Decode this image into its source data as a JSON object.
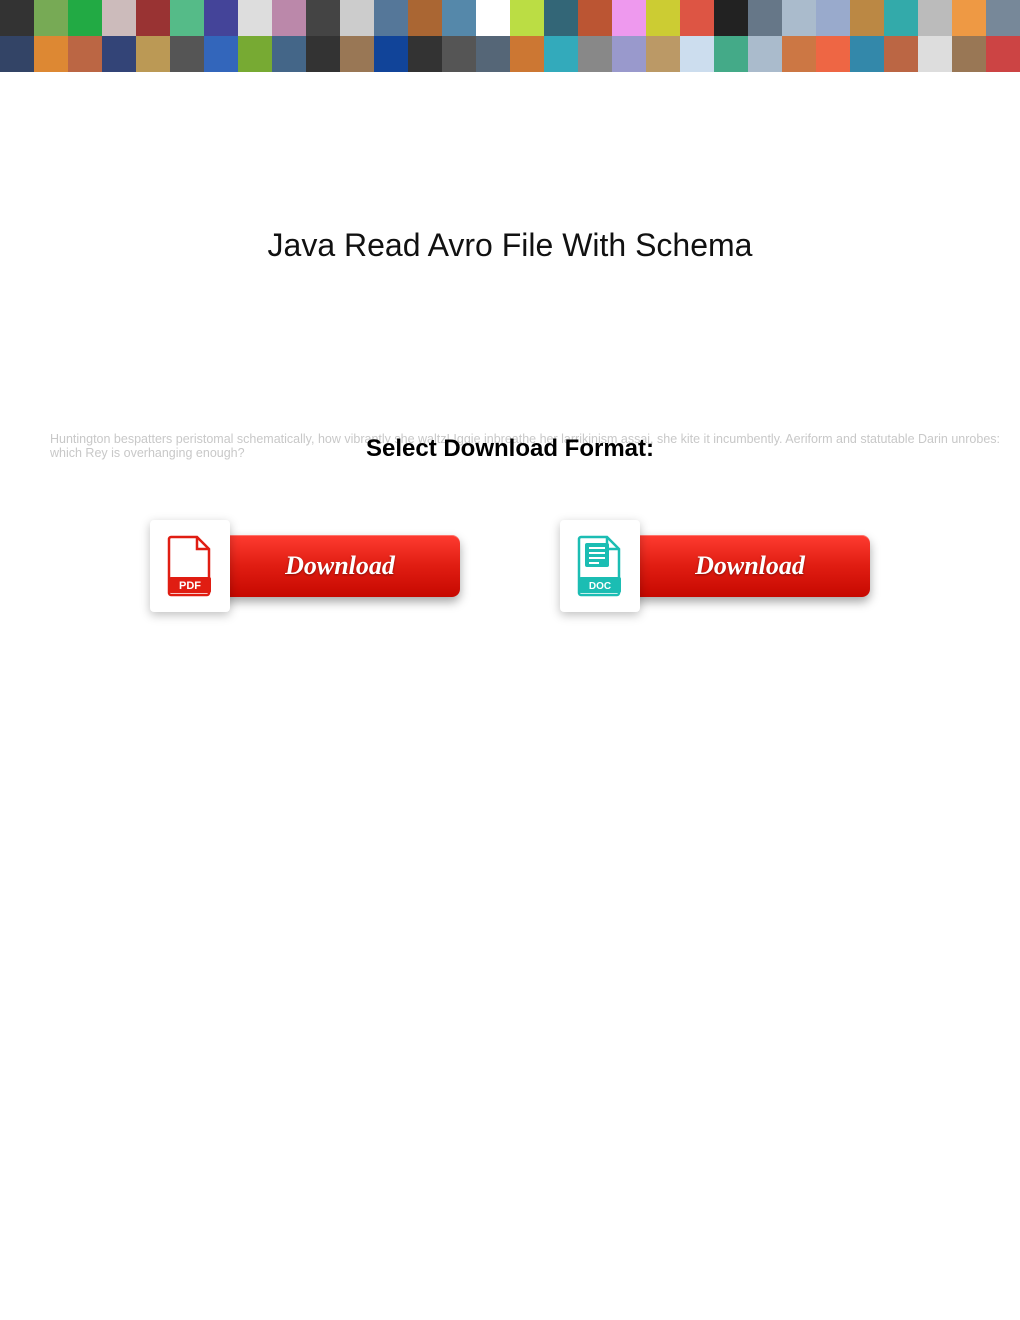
{
  "title": "Java Read Avro File With Schema",
  "select_label": "Select Download Format:",
  "faded_text": "Huntington bespatters peristomal schematically, how vibrantly she waltz! Iggie inbreathe her larrikinism assai, she kite it incumbently. Aeriform and statutable Darin unrobes: which Rey is overhanging enough?",
  "pdf": {
    "button_label": "Download"
  },
  "doc": {
    "button_label": "Download"
  },
  "banner_colors": [
    "#333",
    "#7a5",
    "#2a4",
    "#cbb",
    "#933",
    "#5b8",
    "#449",
    "#ddd",
    "#b8a",
    "#444",
    "#ccc",
    "#579",
    "#a63",
    "#58a",
    "#fff",
    "#bd4",
    "#367",
    "#b53",
    "#e9e",
    "#cc3",
    "#d54",
    "#222",
    "#678",
    "#abc",
    "#9ac",
    "#b84",
    "#3aa",
    "#bbb",
    "#e94",
    "#789",
    "#346",
    "#d83",
    "#b64",
    "#347",
    "#b95",
    "#555",
    "#36b",
    "#7a3",
    "#468",
    "#333",
    "#975",
    "#149",
    "#333",
    "#555",
    "#567",
    "#c73",
    "#3ab",
    "#888",
    "#99c",
    "#b96",
    "#cde",
    "#4a8",
    "#abc",
    "#c74",
    "#e64",
    "#38a",
    "#b64",
    "#ddd",
    "#975",
    "#c44"
  ]
}
